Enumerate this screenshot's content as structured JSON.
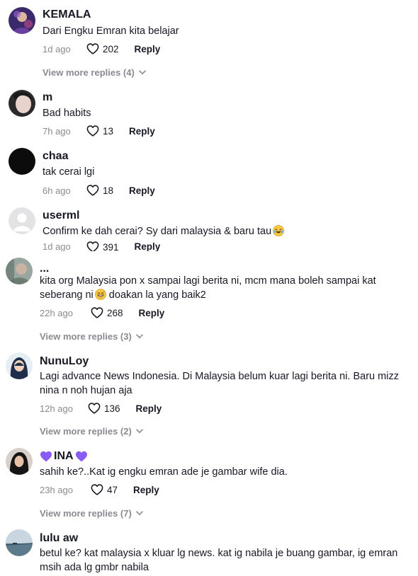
{
  "comments": [
    {
      "username": "KEMALA",
      "text": "Dari Engku Emran kita belajar",
      "time": "1d ago",
      "likes": "202",
      "reply_label": "Reply",
      "view_more": "View more replies (4)"
    },
    {
      "username": "m",
      "text": "Bad habits",
      "time": "7h ago",
      "likes": "13",
      "reply_label": "Reply"
    },
    {
      "username": "chaa",
      "text": "tak cerai lgi",
      "time": "6h ago",
      "likes": "18",
      "reply_label": "Reply"
    },
    {
      "username": "userml",
      "text": "Confirm ke dah cerai? Sy dari malaysia & baru tau",
      "emoji": "laughing-tears",
      "time": "1d ago",
      "likes": "391",
      "reply_label": "Reply"
    },
    {
      "username": "...",
      "text_line1": "kita org Malaysia pon x sampai lagi berita ni, mcm mana boleh sampai kat",
      "text_line2_a": "seberang ni",
      "emoji": "grinning-sweat",
      "text_line2_b": " doakan la yang baik2",
      "time": "22h ago",
      "likes": "268",
      "reply_label": "Reply",
      "view_more": "View more replies (3)"
    },
    {
      "username": "NunuLoy",
      "text_line1": "Lagi advance News Indonesia. Di Malaysia belum kuar lagi berita ni. Baru mizz",
      "text_line2": "nina n noh hujan aja",
      "time": "12h ago",
      "likes": "136",
      "reply_label": "Reply",
      "view_more": "View more replies (2)"
    },
    {
      "username": "INA",
      "text": "sahih ke?..Kat ig engku emran ade je gambar wife dia.",
      "time": "23h ago",
      "likes": "47",
      "reply_label": "Reply",
      "view_more": "View more replies (7)"
    },
    {
      "username": "lulu aw",
      "text_line1": "betul ke? kat malaysia x kluar lg news. kat ig nabila je buang gambar, ig emran",
      "text_line2": "msih ada lg gmbr nabila"
    }
  ],
  "colors": {
    "muted": "#8a8b91",
    "text": "#161823",
    "purple_heart": "#8a5cf6"
  },
  "icons": {
    "like": "heart-outline-icon",
    "expand": "chevron-down-icon"
  }
}
